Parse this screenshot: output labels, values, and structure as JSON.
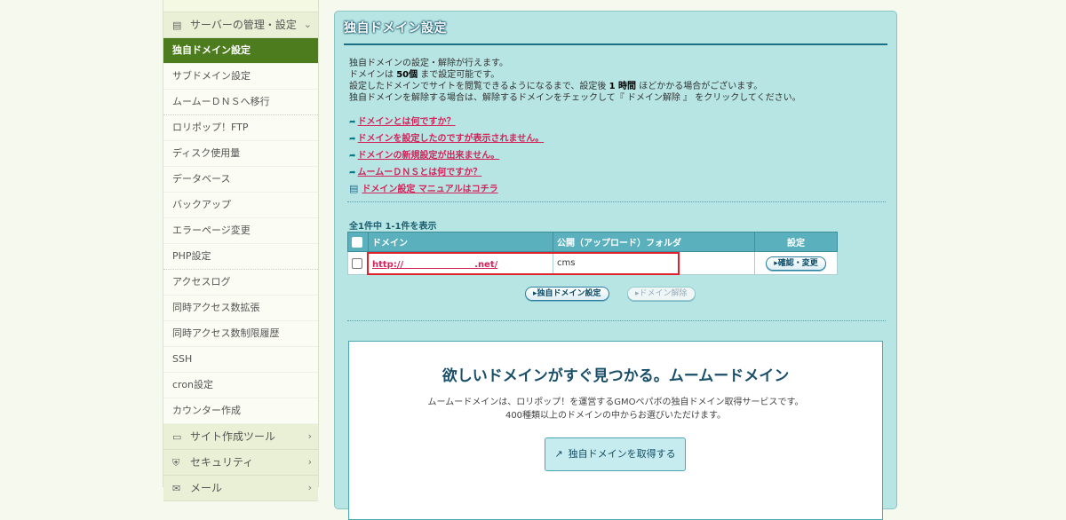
{
  "sidebar": {
    "group_server": "サーバーの管理・設定",
    "items": [
      "独自ドメイン設定",
      "サブドメイン設定",
      "ムームーＤＮＳへ移行",
      "ロリポップ！FTP",
      "ディスク使用量",
      "データベース",
      "バックアップ",
      "エラーページ変更",
      "PHP設定",
      "アクセスログ",
      "同時アクセス数拡張",
      "同時アクセス数制限履歴",
      "SSH",
      "cron設定",
      "カウンター作成"
    ],
    "group_site_tools": "サイト作成ツール",
    "group_security": "セキュリティ",
    "group_mail": "メール"
  },
  "main": {
    "title": "独自ドメイン設定",
    "intro": {
      "line1": "独自ドメインの設定・解除が行えます。",
      "line2_prefix": "ドメインは ",
      "line2_bold": "50個",
      "line2_suffix": " まで設定可能です。",
      "line3_prefix": "設定したドメインでサイトを閲覧できるようになるまで、設定後 ",
      "line3_bold": "1 時間",
      "line3_suffix": " ほどかかる場合がございます。",
      "line4": "独自ドメインを解除する場合は、解除するドメインをチェックして『 ドメイン解除 』 をクリックしてください。"
    },
    "help_links": [
      "ドメインとは何ですか？",
      "ドメインを設定したのですが表示されません。",
      "ドメインの新規設定が出来ません。",
      "ムームーＤＮＳとは何ですか？"
    ],
    "manual_link": "ドメイン設定 マニュアルはコチラ",
    "count_text": "全1件中 1-1件を表示",
    "table": {
      "headers": [
        "ドメイン",
        "公開（アップロード）フォルダ",
        "設定"
      ],
      "rows": [
        {
          "domain": "http://　　　　　　　　.net/",
          "folder": "cms",
          "action": "確認・変更"
        }
      ]
    },
    "btn_add": "独自ドメイン設定",
    "btn_remove": "ドメイン解除"
  },
  "promo": {
    "title": "欲しいドメインがすぐ見つかる。ムームードメイン",
    "desc_line1": "ムームードメインは、ロリポップ！を運営するGMOペパボの独自ドメイン取得サービスです。",
    "desc_line2": "400種類以上のドメインの中からお選びいただけます。",
    "button": "独自ドメインを取得する"
  },
  "colors": {
    "active_nav": "#4d7c1e",
    "panel_bg": "#b7e5e3",
    "link": "#d4245a",
    "table_header": "#5ab1bd",
    "highlight_box": "#e0202a"
  }
}
